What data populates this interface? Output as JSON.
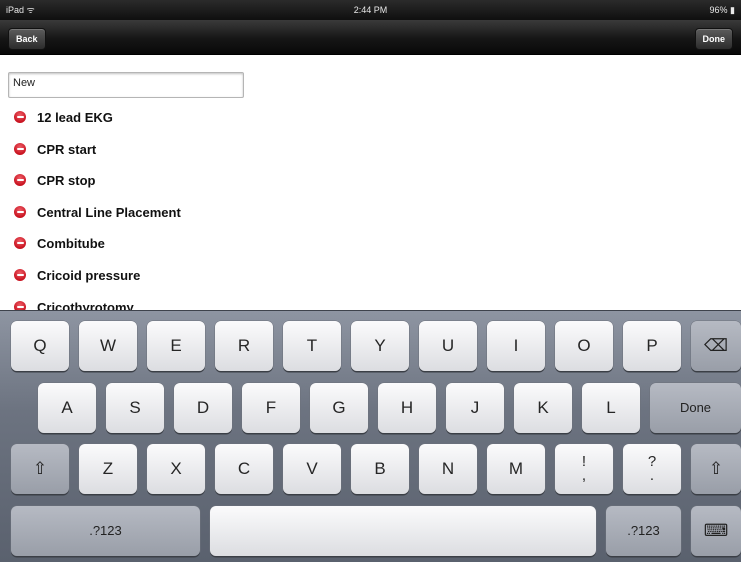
{
  "status_bar": {
    "device": "iPad ᯤ",
    "time": "2:44 PM",
    "battery": "96% ▮"
  },
  "nav_bar": {
    "back_label": "Back",
    "done_label": "Done"
  },
  "search_field": {
    "value": "New"
  },
  "list": {
    "items": [
      "12 lead EKG",
      "CPR start",
      "CPR stop",
      "Central Line Placement",
      "Combitube",
      "Cricoid pressure",
      "Cricothyrotomy"
    ]
  },
  "keyboard": {
    "row1": [
      "Q",
      "W",
      "E",
      "R",
      "T",
      "Y",
      "U",
      "I",
      "O",
      "P"
    ],
    "row2": [
      "A",
      "S",
      "D",
      "F",
      "G",
      "H",
      "J",
      "K",
      "L"
    ],
    "row3": [
      "Z",
      "X",
      "C",
      "V",
      "B",
      "N",
      "M"
    ],
    "done_label": "Done",
    "numbers_label": ".?123",
    "exclaim_top": "!",
    "exclaim_bottom": ",",
    "question_top": "?",
    "question_bottom": ".",
    "backspace_icon": "⌫",
    "shift_icon": "⇧",
    "keyboard_icon": "⌨"
  }
}
